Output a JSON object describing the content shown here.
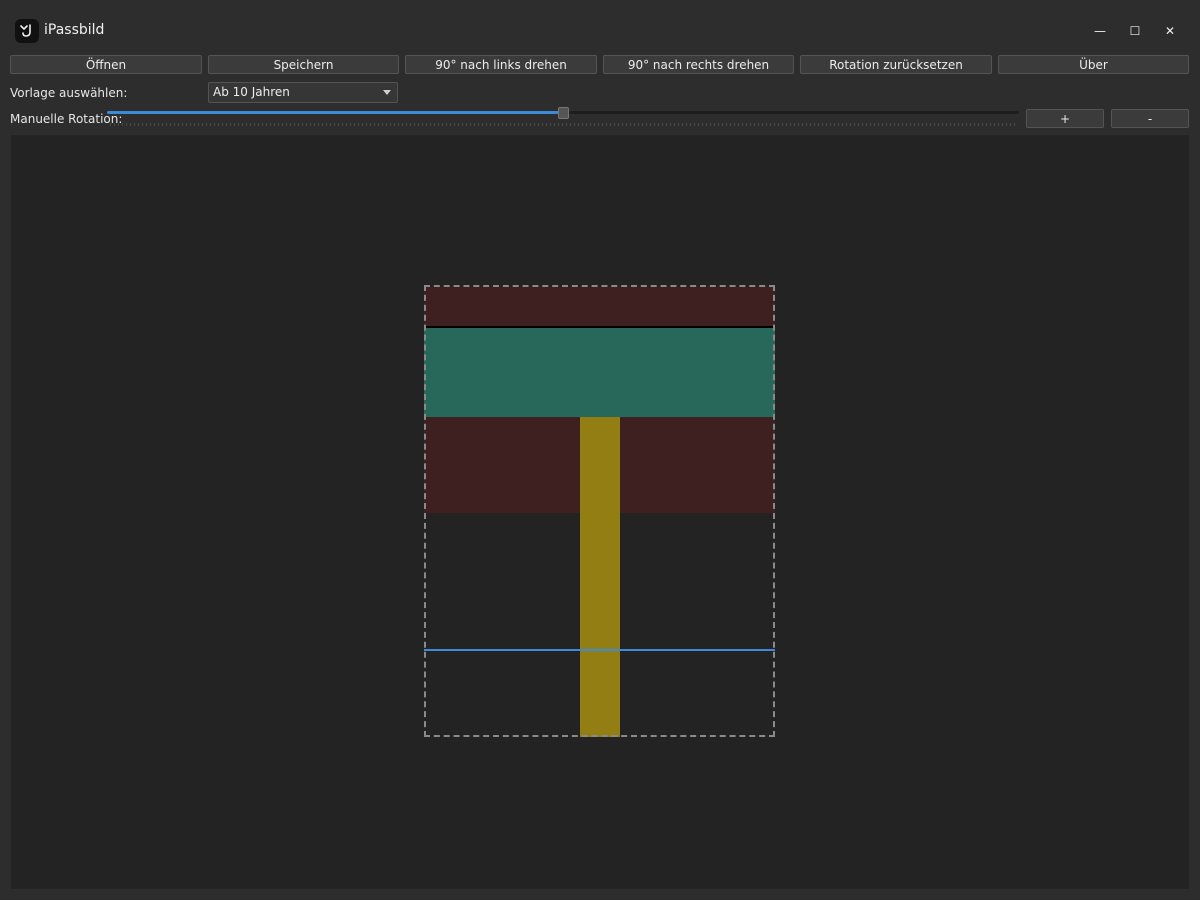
{
  "window": {
    "title": "iPassbild",
    "controls": {
      "minimize": "—",
      "maximize": "☐",
      "close": "✕"
    }
  },
  "toolbar": {
    "buttons": [
      {
        "id": "open",
        "label": "Öffnen"
      },
      {
        "id": "save",
        "label": "Speichern"
      },
      {
        "id": "rotate_left",
        "label": "90° nach links drehen"
      },
      {
        "id": "rotate_right",
        "label": "90° nach rechts drehen"
      },
      {
        "id": "reset_rotation",
        "label": "Rotation zurücksetzen"
      },
      {
        "id": "about",
        "label": "Über"
      }
    ]
  },
  "template": {
    "label": "Vorlage auswählen:",
    "selected": "Ab 10 Jahren"
  },
  "rotation": {
    "label": "Manuelle Rotation:",
    "slider_fraction": 0.5,
    "plus_label": "+",
    "minus_label": "-"
  },
  "colors": {
    "accent": "#3c8bd9",
    "overlay_red": "#3f2020",
    "overlay_green": "#28685a",
    "overlay_yellow": "#937e14",
    "guide_line_black": "#000000",
    "guide_line_blue": "#3c8bd9",
    "crop_border": "#8a8a8a"
  }
}
